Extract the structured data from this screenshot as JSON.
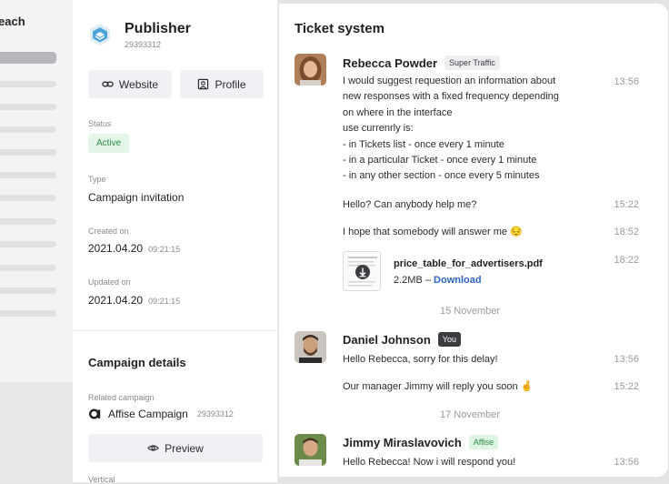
{
  "nav": {
    "title_fragment": "each"
  },
  "publisher": {
    "name": "Publisher",
    "id": "29393312",
    "website_label": "Website",
    "profile_label": "Profile",
    "status_label": "Status",
    "status_value": "Active",
    "type_label": "Type",
    "type_value": "Campaign invitation",
    "created_label": "Created on",
    "created_date": "2021.04.20",
    "created_time": "09:21:15",
    "updated_label": "Updated on",
    "updated_date": "2021.04.20",
    "updated_time": "09:21:15"
  },
  "campaign": {
    "section_title": "Campaign details",
    "related_label": "Related campaign",
    "name": "Affise Campaign",
    "id": "29393312",
    "preview_label": "Preview",
    "cut_label": "Vertical"
  },
  "ticket": {
    "title": "Ticket system",
    "messages": [
      {
        "author": "Rebecca Powder",
        "tag": "Super Traffic",
        "lines": [
          "I would suggest requestion an information about",
          "new responses with a fixed frequency depending",
          "on where in the interface",
          "use currenrly is:",
          "- in Tickets list - once every 1 minute",
          "- in a particular Ticket - once every 1 minute",
          "- in any other section - once every 5 minutes"
        ],
        "time": "13:56"
      },
      {
        "text": "Hello? Can anybody help me?",
        "time": "15:22"
      },
      {
        "text": "I hope that somebody will answer me 😔",
        "time": "18:52"
      },
      {
        "file_name": "price_table_for_advertisers.pdf",
        "file_size": "2.2MB – ",
        "download_label": "Download",
        "time": "18:22"
      },
      {
        "date_separator": "15 November"
      },
      {
        "author": "Daniel Johnson",
        "tag": "You",
        "text": "Hello Rebecca, sorry for this delay!",
        "time": "13:56"
      },
      {
        "text": "Our manager Jimmy will reply you soon 🤞",
        "time": "15:22"
      },
      {
        "date_separator": "17 November"
      },
      {
        "author": "Jimmy Miraslavovich",
        "tag": "Affise",
        "text": "Hello Rebecca! Now i will respond you!",
        "time": "13:56"
      }
    ]
  },
  "colors": {
    "accent_blue": "#2f63c8",
    "active_green": "#2e8a46",
    "panel_bg": "#ffffff",
    "app_bg": "#e4e4e7"
  }
}
